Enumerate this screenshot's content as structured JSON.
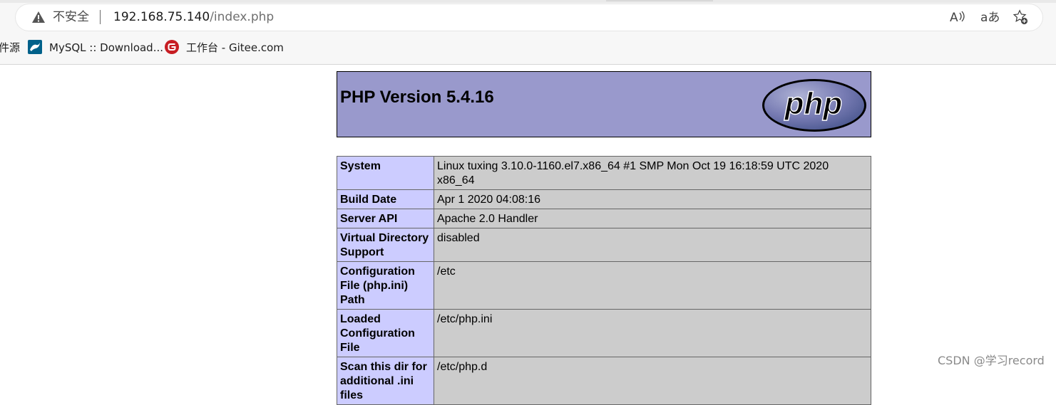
{
  "browser": {
    "security_label": "不安全",
    "url_host": "192.168.75.140",
    "url_path": "/index.php",
    "read_aloud_glyph": "A",
    "translate_glyph": "aあ",
    "icons": [
      "warning-icon",
      "read-aloud-icon",
      "translate-icon",
      "add-favorite-icon"
    ]
  },
  "bookmarks": [
    {
      "label": "件源",
      "icon": "none"
    },
    {
      "label": "MySQL :: Download...",
      "icon": "mysql-icon"
    },
    {
      "label": "工作台 - Gitee.com",
      "icon": "gitee-icon"
    }
  ],
  "phpinfo": {
    "title": "PHP Version 5.4.16",
    "logo_text": "php",
    "colors": {
      "header_bg": "#9999cc",
      "key_bg": "#ccccff",
      "value_bg": "#cccccc"
    },
    "rows": [
      {
        "key": "System",
        "value": "Linux tuxing 3.10.0-1160.el7.x86_64 #1 SMP Mon Oct 19 16:18:59 UTC 2020 x86_64"
      },
      {
        "key": "Build Date",
        "value": "Apr 1 2020 04:08:16"
      },
      {
        "key": "Server API",
        "value": "Apache 2.0 Handler"
      },
      {
        "key": "Virtual Directory Support",
        "value": "disabled"
      },
      {
        "key": "Configuration File (php.ini) Path",
        "value": "/etc"
      },
      {
        "key": "Loaded Configuration File",
        "value": "/etc/php.ini"
      },
      {
        "key": "Scan this dir for additional .ini files",
        "value": "/etc/php.d"
      }
    ]
  },
  "watermark": "CSDN @学习record"
}
